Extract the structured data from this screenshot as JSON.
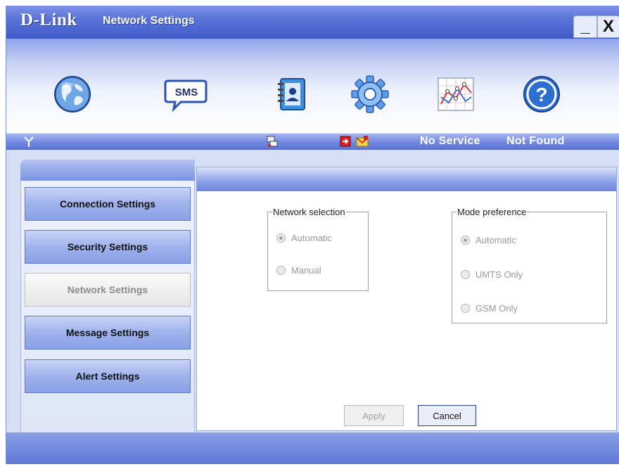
{
  "window": {
    "brand": "D-Link",
    "title": "Network Settings",
    "minimize": "_",
    "close": "X"
  },
  "toolbar": {
    "sms_label": "SMS"
  },
  "statusbar": {
    "service": "No Service",
    "device": "Not Found"
  },
  "nav": {
    "items": [
      {
        "label": "Connection Settings"
      },
      {
        "label": "Security Settings"
      },
      {
        "label": "Network Settings"
      },
      {
        "label": "Message Settings"
      },
      {
        "label": "Alert Settings"
      }
    ]
  },
  "network_selection": {
    "legend": "Network selection",
    "options": [
      {
        "label": "Automatic",
        "checked": true
      },
      {
        "label": "Manual",
        "checked": false
      }
    ]
  },
  "mode_preference": {
    "legend": "Mode preference",
    "options": [
      {
        "label": "Automatic",
        "checked": true
      },
      {
        "label": "UMTS Only",
        "checked": false
      },
      {
        "label": "GSM Only",
        "checked": false
      }
    ]
  },
  "buttons": {
    "apply": "Apply",
    "cancel": "Cancel"
  },
  "colors": {
    "accent": "#5a74d8",
    "nav_button": "#9fb2ec",
    "active_nav": "#e6e6e6"
  }
}
